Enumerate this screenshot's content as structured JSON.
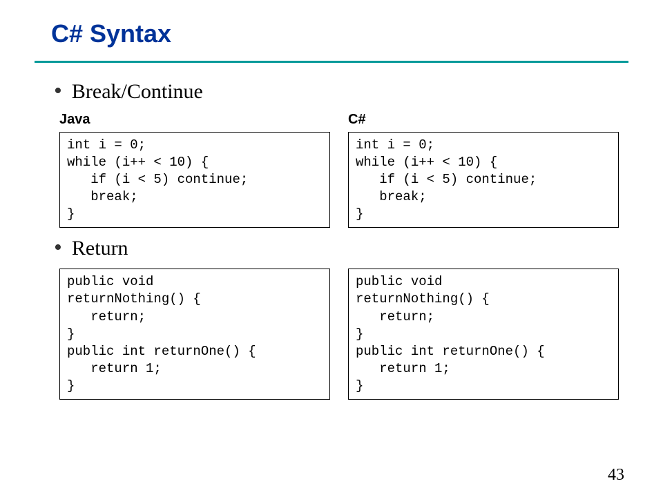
{
  "title": "C# Syntax",
  "bullets": {
    "breakContinue": "Break/Continue",
    "return": "Return"
  },
  "langLabels": {
    "java": "Java",
    "csharp": "C#"
  },
  "code": {
    "java_break": "int i = 0;\nwhile (i++ < 10) {\n   if (i < 5) continue;\n   break;\n}",
    "csharp_break": "int i = 0;\nwhile (i++ < 10) {\n   if (i < 5) continue;\n   break;\n}",
    "java_return": "public void\nreturnNothing() {\n   return;\n}\npublic int returnOne() {\n   return 1;\n}",
    "csharp_return": "public void\nreturnNothing() {\n   return;\n}\npublic int returnOne() {\n   return 1;\n}"
  },
  "pageNumber": "43"
}
